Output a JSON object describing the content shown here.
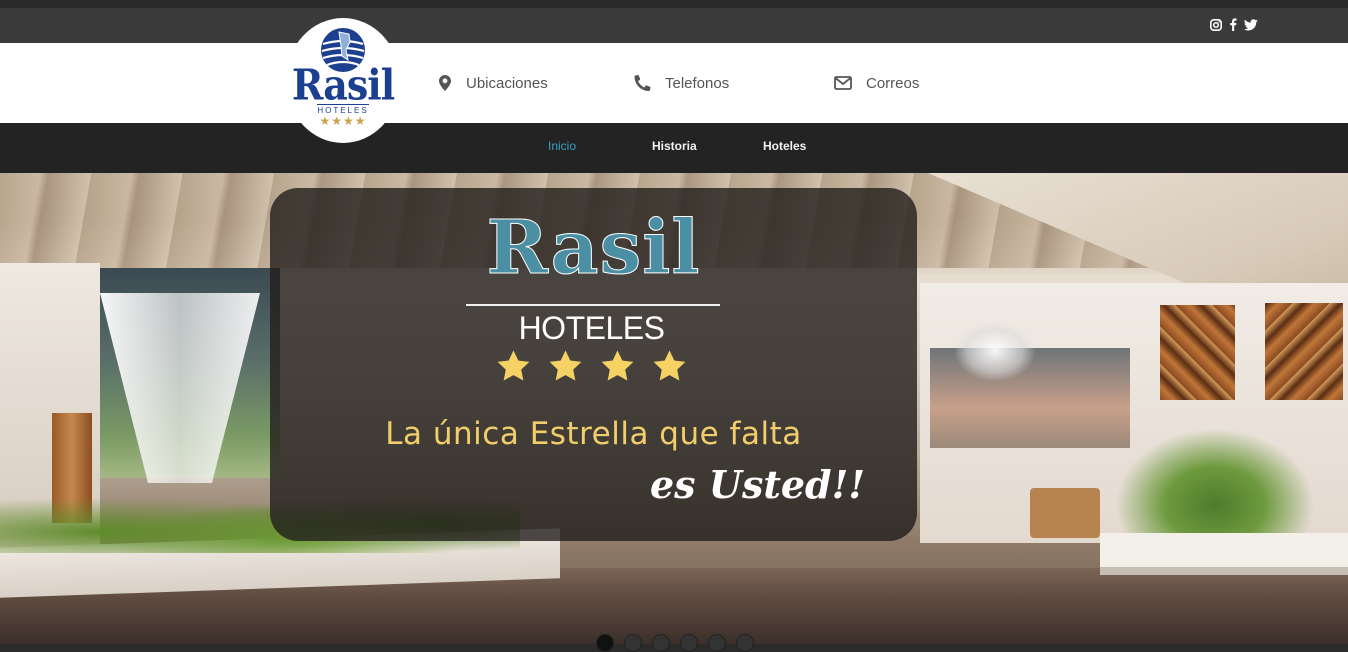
{
  "header": {
    "social": {
      "icons": [
        "instagram-icon",
        "facebook-icon",
        "twitter-icon"
      ]
    },
    "logo": {
      "brand": "Rasil",
      "sub": "HOTELES",
      "stars": "★★★★"
    },
    "contacts": [
      {
        "icon": "map-marker-icon",
        "label": "Ubicaciones"
      },
      {
        "icon": "phone-icon",
        "label": "Telefonos"
      },
      {
        "icon": "envelope-icon",
        "label": "Correos"
      }
    ]
  },
  "nav": {
    "items": [
      {
        "label": "Inicio",
        "active": true
      },
      {
        "label": "Historia",
        "active": false
      },
      {
        "label": "Hoteles",
        "active": false
      }
    ],
    "active_color": "#3a9fc6"
  },
  "hero": {
    "brand": "Rasil",
    "sub": "HOTELES",
    "star_count": 4,
    "tagline": "La única Estrella que falta",
    "tagline2": "es Usted!!",
    "slide_count": 6,
    "active_slide": 1
  },
  "colors": {
    "topbar": "#3a3a3b",
    "navbar": "#232323",
    "brand_blue": "#1d3f8f",
    "hero_brand": "#4a8fa4",
    "gold": "#f1ce6b",
    "star": "#f6d264"
  }
}
